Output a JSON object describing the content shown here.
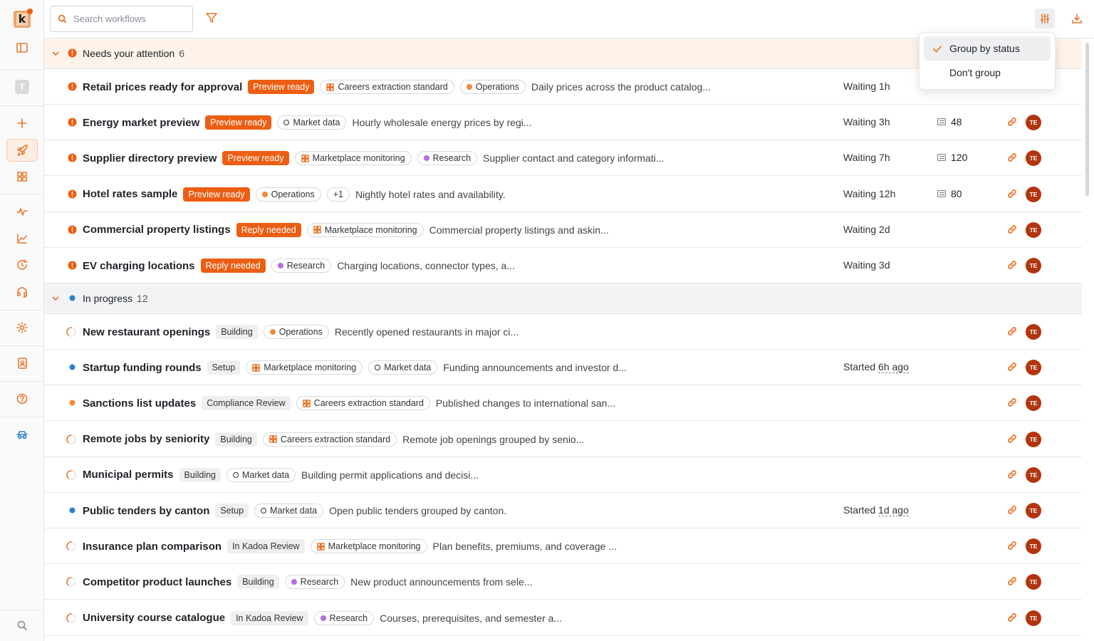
{
  "app": {
    "logo_letter": "k",
    "workspace_initial": "T"
  },
  "search": {
    "placeholder": "Search workflows"
  },
  "dropdown": {
    "options": [
      "Group by status",
      "Don't group"
    ],
    "selected": "Group by status"
  },
  "groups": [
    {
      "title": "Needs your attention",
      "count": "6",
      "rows": [
        {
          "title": "Retail prices ready for approval",
          "badge": "Preview ready",
          "tags": [
            {
              "label": "Careers extraction standard",
              "kind": "grid"
            },
            {
              "label": "Operations",
              "kind": "dot-orange"
            }
          ],
          "desc": "Daily prices across the product catalog...",
          "time": "Waiting 1h",
          "records": ""
        },
        {
          "title": "Energy market preview",
          "badge": "Preview ready",
          "tags": [
            {
              "label": "Market data",
              "kind": "hollow"
            }
          ],
          "desc": "Hourly wholesale energy prices by regi...",
          "time": "Waiting 3h",
          "records": "48"
        },
        {
          "title": "Supplier directory preview",
          "badge": "Preview ready",
          "tags": [
            {
              "label": "Marketplace monitoring",
              "kind": "grid"
            },
            {
              "label": "Research",
              "kind": "dot-purple"
            }
          ],
          "desc": "Supplier contact and category informati...",
          "time": "Waiting 7h",
          "records": "120"
        },
        {
          "title": "Hotel rates sample",
          "badge": "Preview ready",
          "tags": [
            {
              "label": "Operations",
              "kind": "dot-orange"
            },
            {
              "label": "+1",
              "kind": "plain"
            }
          ],
          "desc": "Nightly hotel rates and availability.",
          "time": "Waiting 12h",
          "records": "80"
        },
        {
          "title": "Commercial property listings",
          "badge": "Reply needed",
          "tags": [
            {
              "label": "Marketplace monitoring",
              "kind": "grid"
            }
          ],
          "desc": "Commercial property listings and askin...",
          "time": "Waiting 2d",
          "records": ""
        },
        {
          "title": "EV charging locations",
          "badge": "Reply needed",
          "tags": [
            {
              "label": "Research",
              "kind": "dot-purple"
            }
          ],
          "desc": "Charging locations, connector types, a...",
          "time": "Waiting 3d",
          "records": ""
        }
      ]
    },
    {
      "title": "In progress",
      "count": "12",
      "rows": [
        {
          "title": "New restaurant openings",
          "badge": "Building",
          "tags": [
            {
              "label": "Operations",
              "kind": "dot-orange"
            }
          ],
          "desc": "Recently opened restaurants in major ci...",
          "status": "building",
          "started_prefix": "",
          "started_value": ""
        },
        {
          "title": "Startup funding rounds",
          "badge": "Setup",
          "tags": [
            {
              "label": "Marketplace monitoring",
              "kind": "grid"
            },
            {
              "label": "Market data",
              "kind": "hollow"
            }
          ],
          "desc": "Funding announcements and investor d...",
          "status": "setup",
          "started_prefix": "Started ",
          "started_value": "6h ago"
        },
        {
          "title": "Sanctions list updates",
          "badge": "Compliance Review",
          "tags": [
            {
              "label": "Careers extraction standard",
              "kind": "grid"
            }
          ],
          "desc": "Published changes to international san...",
          "status": "review",
          "started_prefix": "",
          "started_value": ""
        },
        {
          "title": "Remote jobs by seniority",
          "badge": "Building",
          "tags": [
            {
              "label": "Careers extraction standard",
              "kind": "grid"
            }
          ],
          "desc": "Remote job openings grouped by senio...",
          "status": "building",
          "started_prefix": "",
          "started_value": ""
        },
        {
          "title": "Municipal permits",
          "badge": "Building",
          "tags": [
            {
              "label": "Market data",
              "kind": "hollow"
            }
          ],
          "desc": "Building permit applications and decisi...",
          "status": "building",
          "started_prefix": "",
          "started_value": ""
        },
        {
          "title": "Public tenders by canton",
          "badge": "Setup",
          "tags": [
            {
              "label": "Market data",
              "kind": "hollow"
            }
          ],
          "desc": "Open public tenders grouped by canton.",
          "status": "setup",
          "started_prefix": "Started ",
          "started_value": "1d ago"
        },
        {
          "title": "Insurance plan comparison",
          "badge": "In Kadoa Review",
          "tags": [
            {
              "label": "Marketplace monitoring",
              "kind": "grid"
            }
          ],
          "desc": "Plan benefits, premiums, and coverage ...",
          "status": "building",
          "started_prefix": "",
          "started_value": ""
        },
        {
          "title": "Competitor product launches",
          "badge": "Building",
          "tags": [
            {
              "label": "Research",
              "kind": "dot-purple"
            }
          ],
          "desc": "New product announcements from sele...",
          "status": "building",
          "started_prefix": "",
          "started_value": ""
        },
        {
          "title": "University course catalogue",
          "badge": "In Kadoa Review",
          "tags": [
            {
              "label": "Research",
              "kind": "dot-purple"
            }
          ],
          "desc": "Courses, prerequisites, and semester a...",
          "status": "building",
          "started_prefix": "",
          "started_value": ""
        }
      ]
    }
  ],
  "avatar_initials": "TE",
  "colors": {
    "accent": "#e8772e",
    "badge_orange": "#ec5e13",
    "avatar": "#b3350e",
    "setup_blue": "#2d7fd3",
    "research_purple": "#b56ee0"
  }
}
